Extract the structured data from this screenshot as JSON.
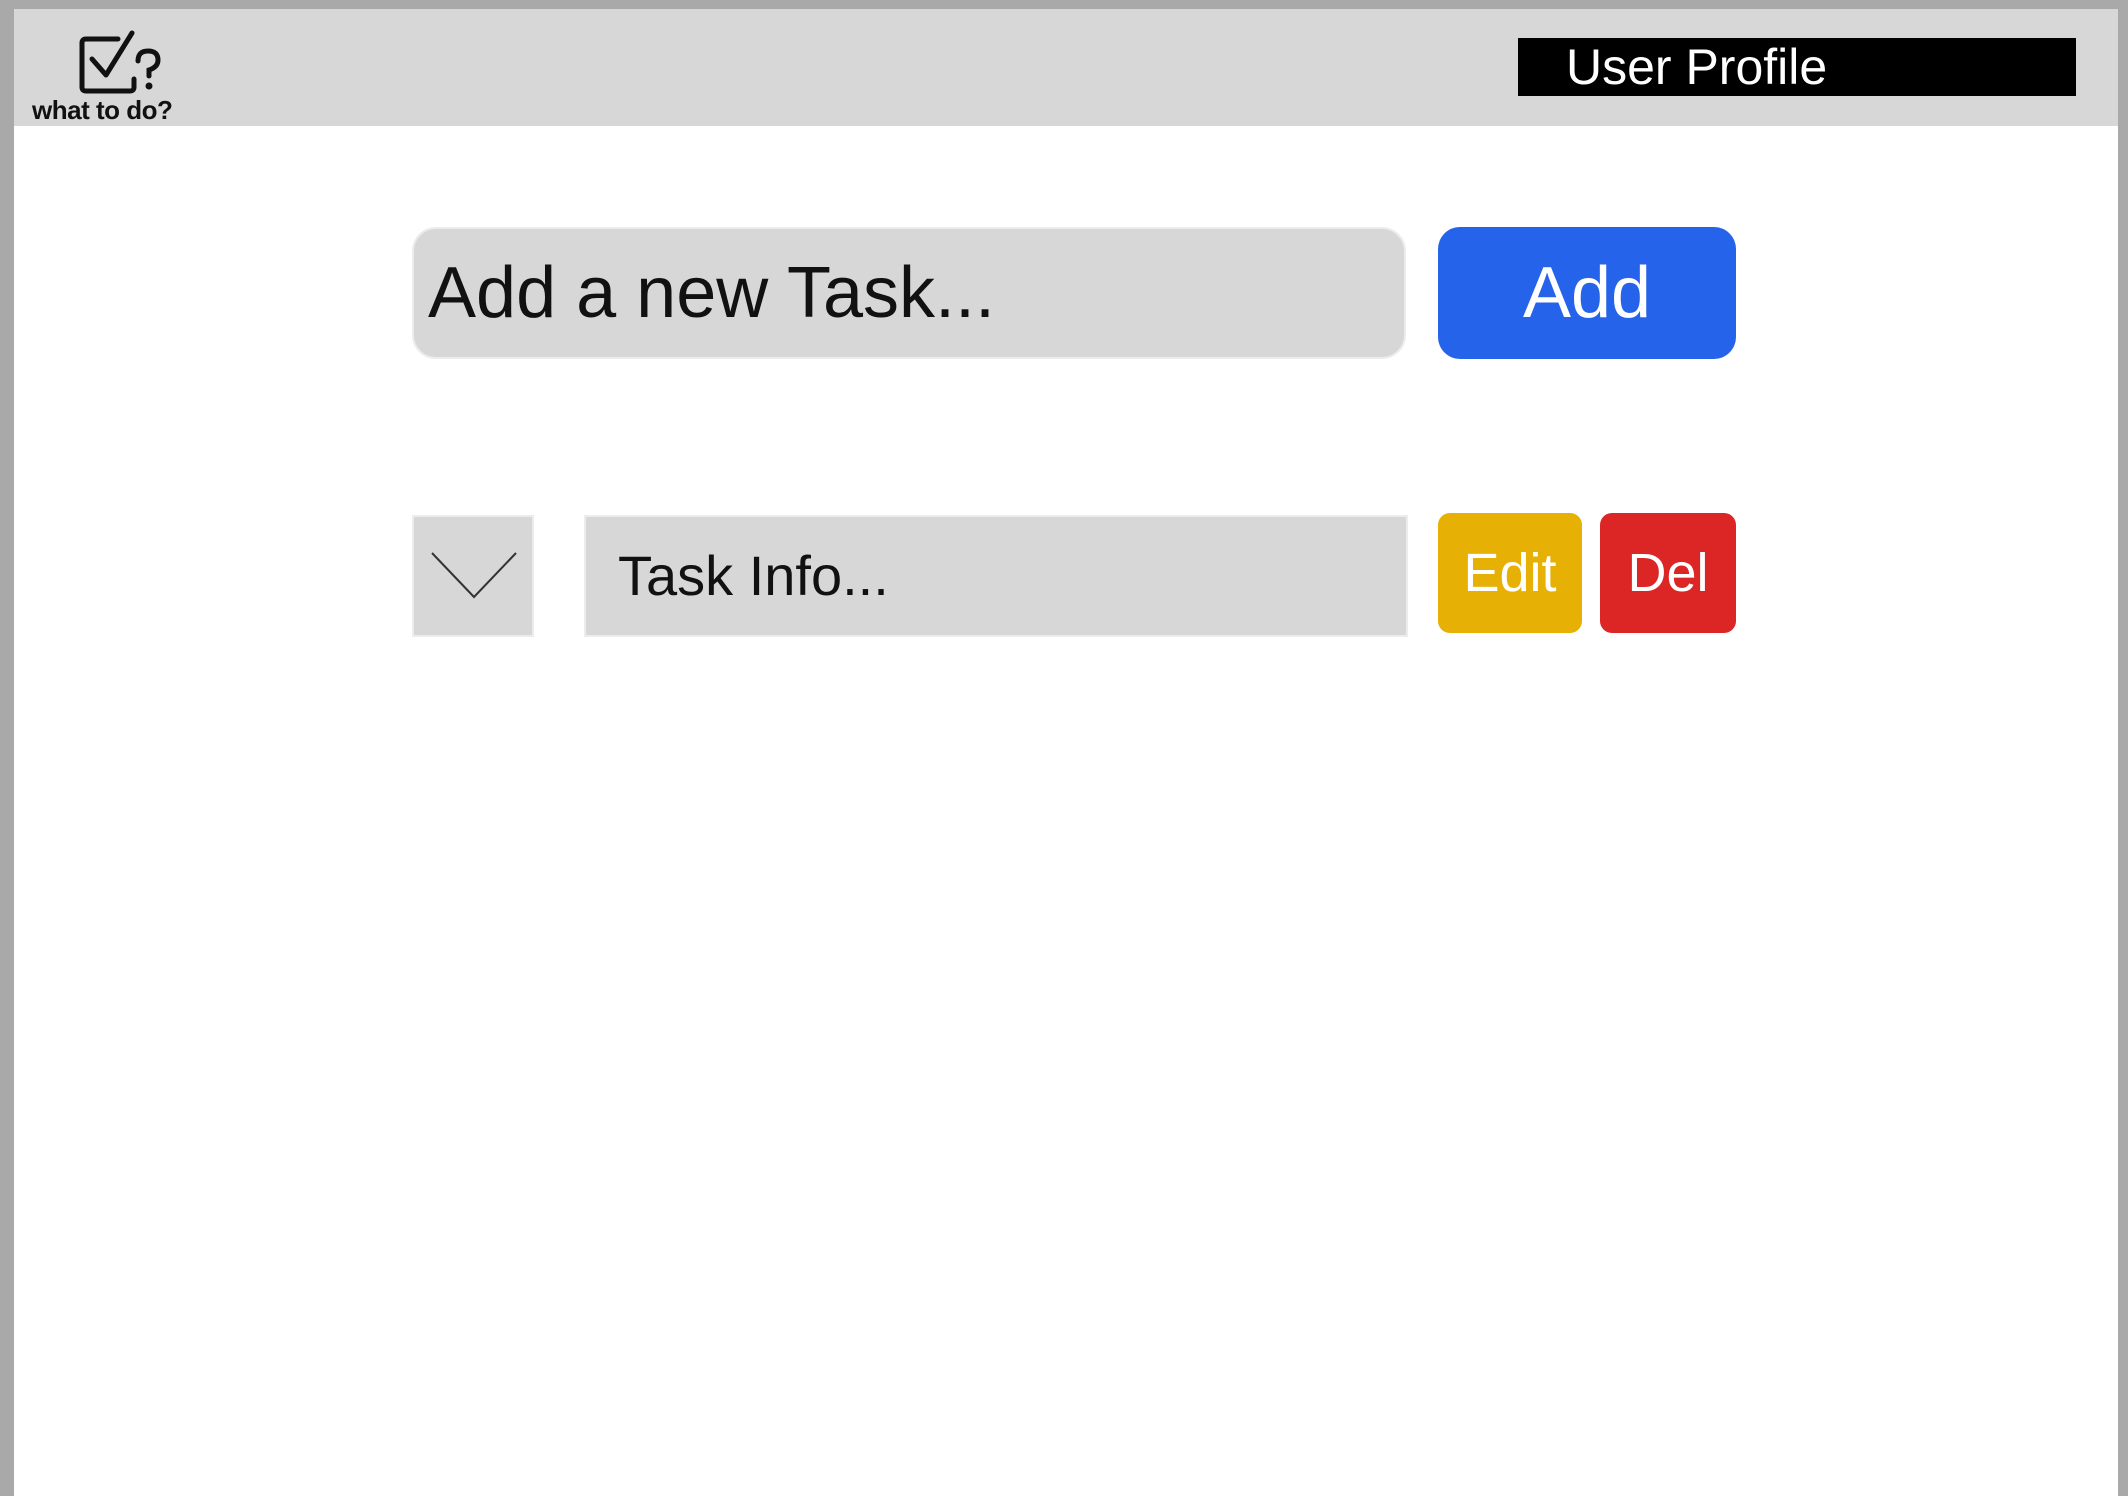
{
  "header": {
    "logo": {
      "icon": "checkbox-question-icon",
      "text": "what to do?"
    },
    "profile_label": "User Profile"
  },
  "new_task": {
    "placeholder": "Add a new Task...",
    "add_label": "Add"
  },
  "tasks": [
    {
      "toggle_icon": "chevron-down-icon",
      "info": "Task Info...",
      "edit_label": "Edit",
      "delete_label": "Del"
    }
  ],
  "colors": {
    "header_bg": "#d7d7d7",
    "profile_bg": "#000000",
    "add_button": "#2563eb",
    "edit_button": "#e6b005",
    "delete_button": "#dc2626",
    "field_bg": "#d7d7d7"
  }
}
